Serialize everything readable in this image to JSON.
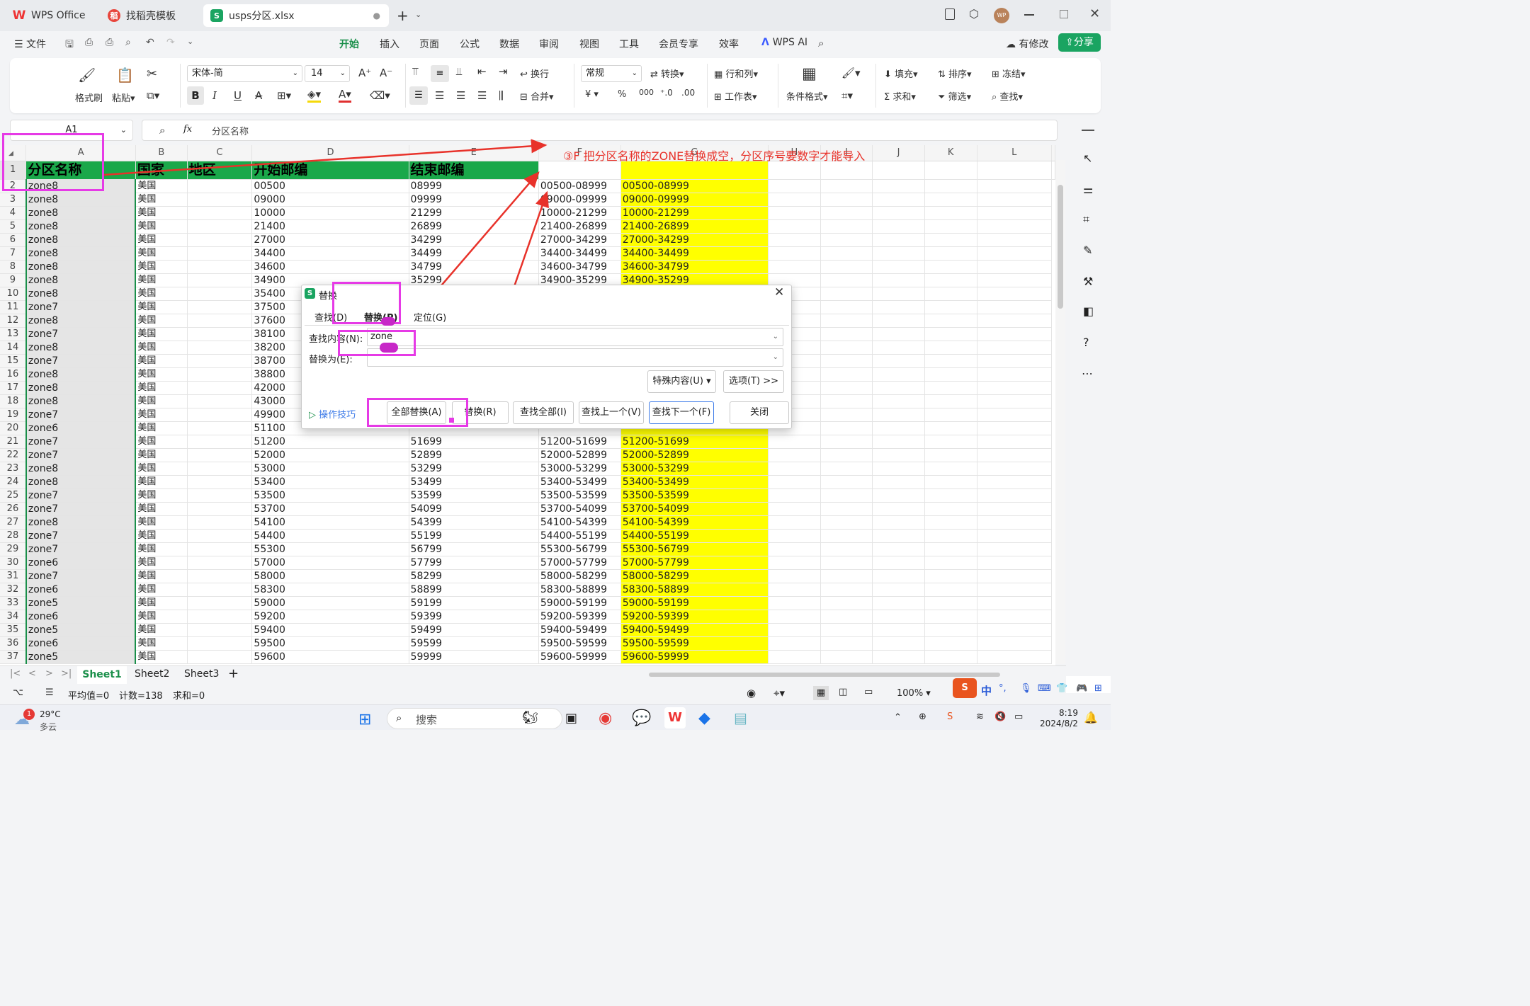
{
  "tabs": [
    {
      "label": "WPS Office",
      "icon": "wps-logo-icon"
    },
    {
      "label": "找稻壳模板",
      "icon": "docer-icon"
    },
    {
      "label": "usps分区.xlsx",
      "icon": "sheet-s-icon"
    }
  ],
  "window": {
    "avatar": "WP"
  },
  "menu": {
    "file": "文件",
    "items": [
      "开始",
      "插入",
      "页面",
      "公式",
      "数据",
      "审阅",
      "视图",
      "工具",
      "会员专享",
      "效率"
    ],
    "active": "开始",
    "wpsai": "WPS AI",
    "modified": "有修改",
    "share": "分享"
  },
  "ribbon": {
    "format_painter": "格式刷",
    "paste": "粘贴",
    "font": "宋体-简",
    "size": "14",
    "wrap": "换行",
    "merge": "合并",
    "numfmt": "常规",
    "convert": "转换",
    "rowcol": "行和列",
    "worksheet": "工作表",
    "cond": "条件格式",
    "fill": "填充",
    "sort": "排序",
    "freeze": "冻结",
    "sum": "求和",
    "filter": "筛选",
    "find": "查找",
    "currency": "¥",
    "percent": "%",
    "thousands": "000"
  },
  "formula": {
    "cell": "A1",
    "fx": "fx",
    "value": "分区名称"
  },
  "columns": [
    "A",
    "B",
    "C",
    "D",
    "E",
    "F",
    "G",
    "H",
    "I",
    "J",
    "K",
    "L"
  ],
  "header_row": [
    "分区名称",
    "国家",
    "地区",
    "开始邮编",
    "结束邮编"
  ],
  "rows": [
    [
      "2",
      "zone8",
      "美国",
      "",
      "00500",
      "08999",
      "00500-08999",
      "00500-08999"
    ],
    [
      "3",
      "zone8",
      "美国",
      "",
      "09000",
      "09999",
      "09000-09999",
      "09000-09999"
    ],
    [
      "4",
      "zone8",
      "美国",
      "",
      "10000",
      "21299",
      "10000-21299",
      "10000-21299"
    ],
    [
      "5",
      "zone8",
      "美国",
      "",
      "21400",
      "26899",
      "21400-26899",
      "21400-26899"
    ],
    [
      "6",
      "zone8",
      "美国",
      "",
      "27000",
      "34299",
      "27000-34299",
      "27000-34299"
    ],
    [
      "7",
      "zone8",
      "美国",
      "",
      "34400",
      "34499",
      "34400-34499",
      "34400-34499"
    ],
    [
      "8",
      "zone8",
      "美国",
      "",
      "34600",
      "34799",
      "34600-34799",
      "34600-34799"
    ],
    [
      "9",
      "zone8",
      "美国",
      "",
      "34900",
      "35299",
      "34900-35299",
      "34900-35299"
    ],
    [
      "10",
      "zone8",
      "美国",
      "",
      "35400",
      "",
      "",
      ""
    ],
    [
      "11",
      "zone7",
      "美国",
      "",
      "37500",
      "",
      "",
      ""
    ],
    [
      "12",
      "zone8",
      "美国",
      "",
      "37600",
      "",
      "",
      ""
    ],
    [
      "13",
      "zone7",
      "美国",
      "",
      "38100",
      "",
      "",
      ""
    ],
    [
      "14",
      "zone8",
      "美国",
      "",
      "38200",
      "",
      "",
      ""
    ],
    [
      "15",
      "zone7",
      "美国",
      "",
      "38700",
      "",
      "",
      ""
    ],
    [
      "16",
      "zone8",
      "美国",
      "",
      "38800",
      "",
      "",
      ""
    ],
    [
      "17",
      "zone8",
      "美国",
      "",
      "42000",
      "",
      "",
      ""
    ],
    [
      "18",
      "zone8",
      "美国",
      "",
      "43000",
      "",
      "",
      ""
    ],
    [
      "19",
      "zone7",
      "美国",
      "",
      "49900",
      "",
      "",
      ""
    ],
    [
      "20",
      "zone6",
      "美国",
      "",
      "51100",
      "",
      "",
      ""
    ],
    [
      "21",
      "zone7",
      "美国",
      "",
      "51200",
      "51699",
      "51200-51699",
      "51200-51699"
    ],
    [
      "22",
      "zone7",
      "美国",
      "",
      "52000",
      "52899",
      "52000-52899",
      "52000-52899"
    ],
    [
      "23",
      "zone8",
      "美国",
      "",
      "53000",
      "53299",
      "53000-53299",
      "53000-53299"
    ],
    [
      "24",
      "zone8",
      "美国",
      "",
      "53400",
      "53499",
      "53400-53499",
      "53400-53499"
    ],
    [
      "25",
      "zone7",
      "美国",
      "",
      "53500",
      "53599",
      "53500-53599",
      "53500-53599"
    ],
    [
      "26",
      "zone7",
      "美国",
      "",
      "53700",
      "54099",
      "53700-54099",
      "53700-54099"
    ],
    [
      "27",
      "zone8",
      "美国",
      "",
      "54100",
      "54399",
      "54100-54399",
      "54100-54399"
    ],
    [
      "28",
      "zone7",
      "美国",
      "",
      "54400",
      "55199",
      "54400-55199",
      "54400-55199"
    ],
    [
      "29",
      "zone7",
      "美国",
      "",
      "55300",
      "56799",
      "55300-56799",
      "55300-56799"
    ],
    [
      "30",
      "zone6",
      "美国",
      "",
      "57000",
      "57799",
      "57000-57799",
      "57000-57799"
    ],
    [
      "31",
      "zone7",
      "美国",
      "",
      "58000",
      "58299",
      "58000-58299",
      "58000-58299"
    ],
    [
      "32",
      "zone6",
      "美国",
      "",
      "58300",
      "58899",
      "58300-58899",
      "58300-58899"
    ],
    [
      "33",
      "zone5",
      "美国",
      "",
      "59000",
      "59199",
      "59000-59199",
      "59000-59199"
    ],
    [
      "34",
      "zone6",
      "美国",
      "",
      "59200",
      "59399",
      "59200-59399",
      "59200-59399"
    ],
    [
      "35",
      "zone5",
      "美国",
      "",
      "59400",
      "59499",
      "59400-59499",
      "59400-59499"
    ],
    [
      "36",
      "zone6",
      "美国",
      "",
      "59500",
      "59599",
      "59500-59599",
      "59500-59599"
    ],
    [
      "37",
      "zone5",
      "美国",
      "",
      "59600",
      "59999",
      "59600-59999",
      "59600-59999"
    ]
  ],
  "annotation": "③F 把分区名称的ZONE替换成空，分区序号要数字才能导入",
  "dialog": {
    "title": "替换",
    "tabs": [
      "查找(D)",
      "替换(P)",
      "定位(G)"
    ],
    "find_label": "查找内容(N):",
    "find_value": "zone",
    "replace_label": "替换为(E):",
    "replace_value": "",
    "special": "特殊内容(U)",
    "options": "选项(T) >>",
    "tips": "操作技巧",
    "buttons": [
      "全部替换(A)",
      "替换(R)",
      "查找全部(I)",
      "查找上一个(V)",
      "查找下一个(F)",
      "关闭"
    ]
  },
  "sheets": [
    "Sheet1",
    "Sheet2",
    "Sheet3"
  ],
  "active_sheet": "Sheet1",
  "status": {
    "avg": "平均值=0",
    "count": "计数=138",
    "sum": "求和=0",
    "zoom": "100%"
  },
  "taskbar": {
    "weather_temp": "29°C",
    "weather_text": "多云",
    "weather_badge": "1",
    "search": "搜索",
    "ime": "中",
    "time": "8:19",
    "date": "2024/8/2"
  },
  "colors": {
    "header_green": "#1aa84a",
    "highlight_yellow": "#ffff00",
    "annotation_red": "#e8322a",
    "magenta": "#e63ae6",
    "share_green": "#1aa461"
  }
}
